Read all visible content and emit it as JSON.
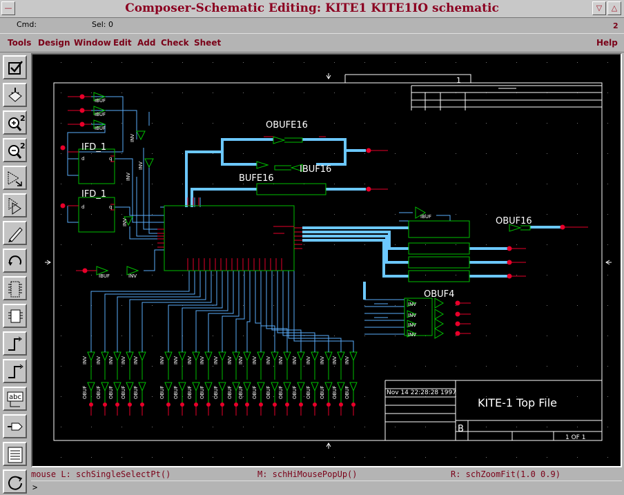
{
  "window": {
    "title": "Composer-Schematic Editing: KITE1 KITE1IO schematic",
    "close_glyph": "—",
    "min_glyph": "▽",
    "max_glyph": "△"
  },
  "cmdbar": {
    "cmd_label": "Cmd:",
    "sel_label": "Sel: 0",
    "count": "2"
  },
  "menu": [
    "Tools",
    "Design",
    "Window",
    "Edit",
    "Add",
    "Check",
    "Sheet"
  ],
  "menu_help": "Help",
  "tools": [
    {
      "name": "check-save-icon",
      "zoom": ""
    },
    {
      "name": "save-icon",
      "zoom": ""
    },
    {
      "name": "zoom-in-icon",
      "zoom": "2"
    },
    {
      "name": "zoom-out-icon",
      "zoom": "2"
    },
    {
      "name": "stretch-icon",
      "zoom": ""
    },
    {
      "name": "copy-icon",
      "zoom": ""
    },
    {
      "name": "pencil-icon",
      "zoom": ""
    },
    {
      "name": "undo-icon",
      "zoom": ""
    },
    {
      "name": "add-instance-icon",
      "zoom": ""
    },
    {
      "name": "add-component-icon",
      "zoom": ""
    },
    {
      "name": "add-wire-icon",
      "zoom": ""
    },
    {
      "name": "add-wire-name-icon",
      "zoom": ""
    },
    {
      "name": "add-label-icon",
      "zoom": ""
    },
    {
      "name": "add-pin-icon",
      "zoom": ""
    },
    {
      "name": "property-icon",
      "zoom": ""
    },
    {
      "name": "rotate-icon",
      "zoom": ""
    }
  ],
  "tool_text": {
    "abc": "abc"
  },
  "schematic": {
    "obufe16_top": "OBUFE16",
    "ibuf16": "IBUF16",
    "bufe16": "BUFE16",
    "ifd_1": "IFD_1",
    "ifd_2": "IFD_1",
    "obuf16_right": "OBUF16",
    "obuf4": "OBUF4",
    "ibuf": "IBUF",
    "inv": "INV",
    "obuf": "OBUF",
    "tb_date": "Nov 14 22:28:28 1997",
    "tb_title": "KITE-1 Top File",
    "tb_sheet": "1 OF 1",
    "tb_rev": "B",
    "tb_num": "1"
  },
  "status": {
    "mouse_l": "mouse L: schSingleSelectPt()",
    "mouse_m": "M: schHiMousePopUp()",
    "mouse_r": "R: schZoomFit(1.0 0.9)"
  },
  "prompt": ">",
  "colors": {
    "net_thin": "#5aaefc",
    "net_bus": "#6cc8ff",
    "component": "#00c000",
    "pin": "#e8002a",
    "frame": "#ffffff",
    "label": "#ffffff",
    "menu_text": "#7a0018"
  }
}
